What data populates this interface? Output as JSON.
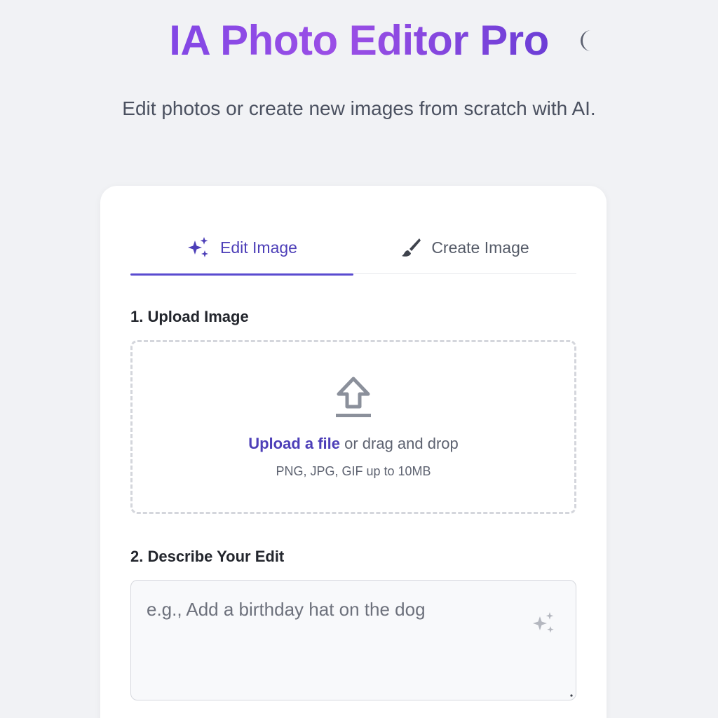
{
  "header": {
    "title": "IA Photo Editor Pro",
    "subtitle": "Edit photos or create new images from scratch with AI.",
    "theme_toggle_icon": "moon-icon"
  },
  "tabs": [
    {
      "label": "Edit Image",
      "icon": "sparkles-icon",
      "active": true
    },
    {
      "label": "Create Image",
      "icon": "paintbrush-icon",
      "active": false
    }
  ],
  "upload": {
    "section_label": "1. Upload Image",
    "icon": "upload-icon",
    "link_text": "Upload a file",
    "drag_text": " or drag and drop",
    "hint": "PNG, JPG, GIF up to 10MB"
  },
  "edit": {
    "section_label": "2. Describe Your Edit",
    "placeholder": "e.g., Add a birthday hat on the dog",
    "value": "",
    "magic_icon": "sparkles-icon"
  },
  "colors": {
    "accent": "#5a4bd0",
    "title_gradient_start": "#8247e5",
    "title_gradient_end": "#6c3ed6",
    "background": "#f1f2f5"
  }
}
